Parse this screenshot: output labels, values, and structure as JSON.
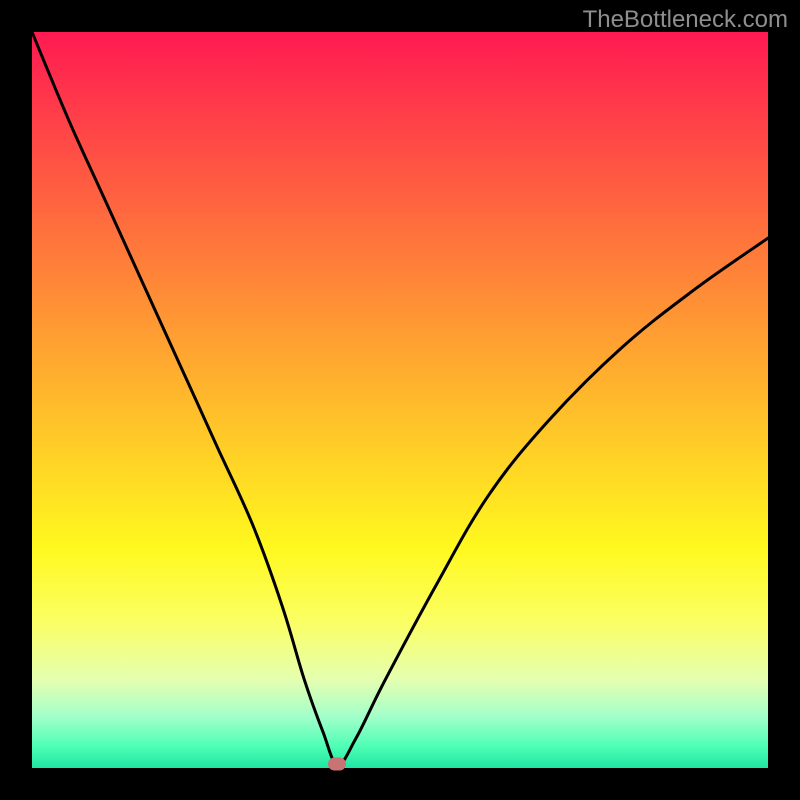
{
  "watermark": "TheBottleneck.com",
  "chart_data": {
    "type": "line",
    "title": "",
    "xlabel": "",
    "ylabel": "",
    "xlim": [
      0,
      100
    ],
    "ylim": [
      0,
      100
    ],
    "grid": false,
    "legend": false,
    "background_gradient": {
      "direction": "vertical",
      "stops": [
        {
          "pos": 0,
          "color": "#ff1a52"
        },
        {
          "pos": 25,
          "color": "#ff6a3e"
        },
        {
          "pos": 55,
          "color": "#ffc928"
        },
        {
          "pos": 80,
          "color": "#fbff63"
        },
        {
          "pos": 93,
          "color": "#a3ffca"
        },
        {
          "pos": 100,
          "color": "#1fe6a1"
        }
      ]
    },
    "series": [
      {
        "name": "bottleneck-curve",
        "color": "#000000",
        "x": [
          0,
          5,
          10,
          15,
          20,
          25,
          30,
          34,
          37,
          39.5,
          41.5,
          44,
          48,
          55,
          62,
          70,
          80,
          90,
          100
        ],
        "y": [
          100,
          88,
          77,
          66,
          55,
          44,
          33,
          22,
          12,
          5,
          0.5,
          4,
          12,
          25,
          37,
          47,
          57,
          65,
          72
        ]
      }
    ],
    "marker": {
      "name": "optimum-dot",
      "x": 41.5,
      "y": 0.5,
      "color": "#c87474"
    }
  }
}
